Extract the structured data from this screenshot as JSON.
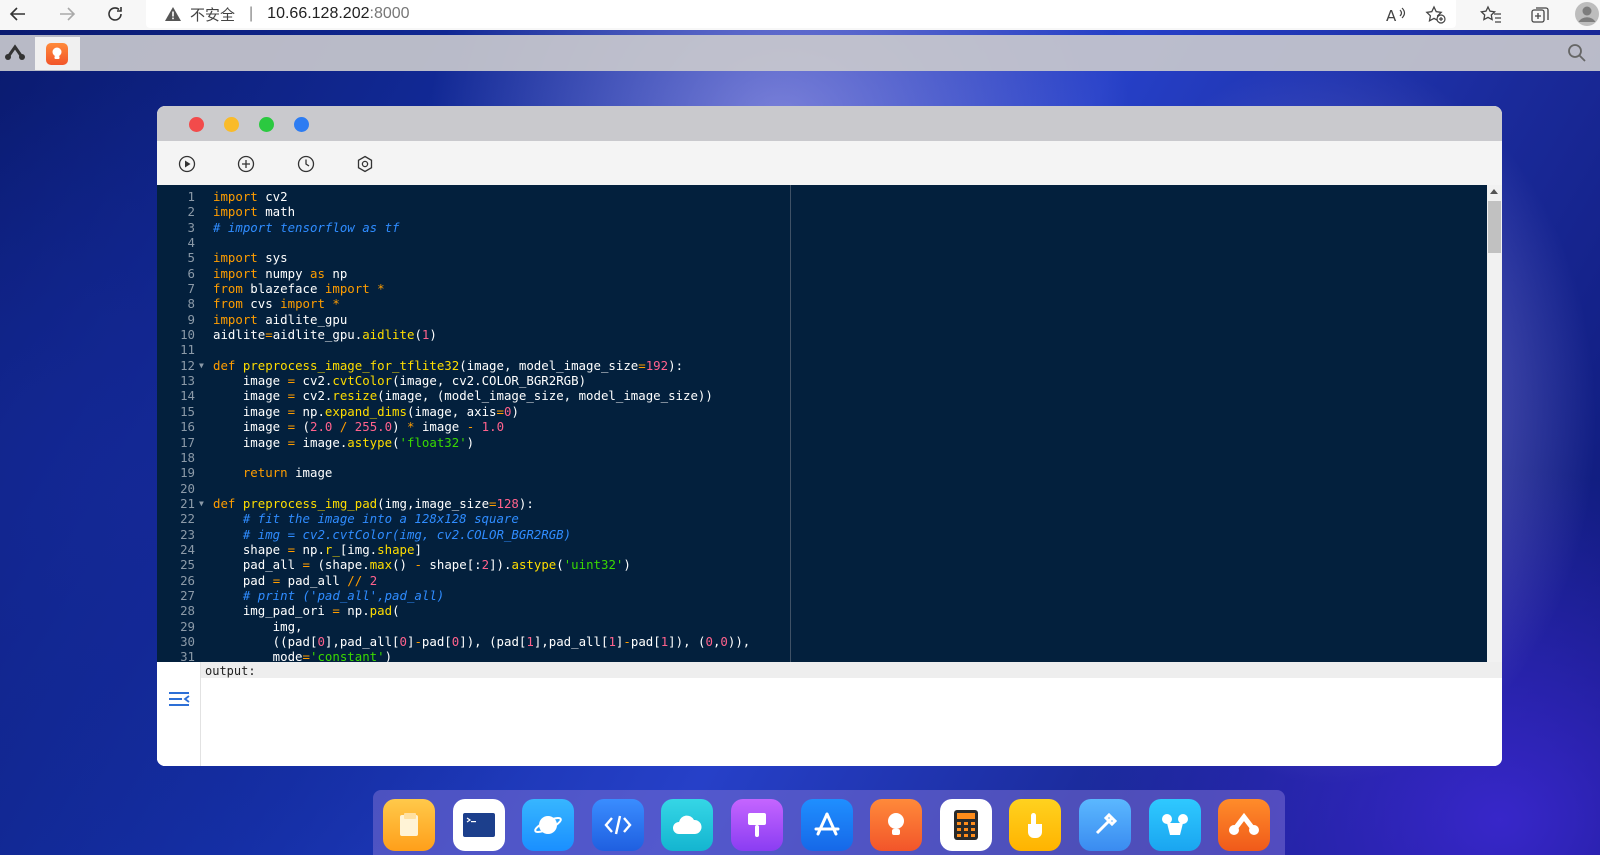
{
  "browser": {
    "insecure_label": "不安全",
    "separator": "|",
    "host": "10.66.128.202",
    "port": ":8000"
  },
  "editor": {
    "lines": [
      {
        "n": "1",
        "fold": false,
        "tokens": [
          [
            "kw",
            "import"
          ],
          [
            "t",
            " cv2"
          ]
        ]
      },
      {
        "n": "2",
        "fold": false,
        "tokens": [
          [
            "kw",
            "import"
          ],
          [
            "t",
            " math"
          ]
        ]
      },
      {
        "n": "3",
        "fold": false,
        "tokens": [
          [
            "cm",
            "# import tensorflow as tf"
          ]
        ]
      },
      {
        "n": "4",
        "fold": false,
        "tokens": []
      },
      {
        "n": "5",
        "fold": false,
        "tokens": [
          [
            "kw",
            "import"
          ],
          [
            "t",
            " sys"
          ]
        ]
      },
      {
        "n": "6",
        "fold": false,
        "tokens": [
          [
            "kw",
            "import"
          ],
          [
            "t",
            " numpy "
          ],
          [
            "kw",
            "as"
          ],
          [
            "t",
            " np"
          ]
        ]
      },
      {
        "n": "7",
        "fold": false,
        "tokens": [
          [
            "kw",
            "from"
          ],
          [
            "t",
            " blazeface "
          ],
          [
            "kw",
            "import"
          ],
          [
            "t",
            " "
          ],
          [
            "op",
            "*"
          ]
        ]
      },
      {
        "n": "8",
        "fold": false,
        "tokens": [
          [
            "kw",
            "from"
          ],
          [
            "t",
            " cvs "
          ],
          [
            "kw",
            "import"
          ],
          [
            "t",
            " "
          ],
          [
            "op",
            "*"
          ]
        ]
      },
      {
        "n": "9",
        "fold": false,
        "tokens": [
          [
            "kw",
            "import"
          ],
          [
            "t",
            " aidlite_gpu"
          ]
        ]
      },
      {
        "n": "10",
        "fold": false,
        "tokens": [
          [
            "t",
            "aidlite"
          ],
          [
            "op",
            "="
          ],
          [
            "t",
            "aidlite_gpu."
          ],
          [
            "fn",
            "aidlite"
          ],
          [
            "t",
            "("
          ],
          [
            "num",
            "1"
          ],
          [
            "t",
            ")"
          ]
        ]
      },
      {
        "n": "11",
        "fold": false,
        "tokens": []
      },
      {
        "n": "12",
        "fold": true,
        "tokens": [
          [
            "kw",
            "def"
          ],
          [
            "t",
            " "
          ],
          [
            "fn",
            "preprocess_image_for_tflite32"
          ],
          [
            "t",
            "(image, model_image_size"
          ],
          [
            "op",
            "="
          ],
          [
            "num",
            "192"
          ],
          [
            "t",
            "):"
          ]
        ]
      },
      {
        "n": "13",
        "fold": false,
        "tokens": [
          [
            "t",
            "    image "
          ],
          [
            "op",
            "="
          ],
          [
            "t",
            " cv2."
          ],
          [
            "fn",
            "cvtColor"
          ],
          [
            "t",
            "(image, cv2.COLOR_BGR2RGB)"
          ]
        ]
      },
      {
        "n": "14",
        "fold": false,
        "tokens": [
          [
            "t",
            "    image "
          ],
          [
            "op",
            "="
          ],
          [
            "t",
            " cv2."
          ],
          [
            "fn",
            "resize"
          ],
          [
            "t",
            "(image, (model_image_size, model_image_size))"
          ]
        ]
      },
      {
        "n": "15",
        "fold": false,
        "tokens": [
          [
            "t",
            "    image "
          ],
          [
            "op",
            "="
          ],
          [
            "t",
            " np."
          ],
          [
            "fn",
            "expand_dims"
          ],
          [
            "t",
            "(image, axis"
          ],
          [
            "op",
            "="
          ],
          [
            "num",
            "0"
          ],
          [
            "t",
            ")"
          ]
        ]
      },
      {
        "n": "16",
        "fold": false,
        "tokens": [
          [
            "t",
            "    image "
          ],
          [
            "op",
            "="
          ],
          [
            "t",
            " ("
          ],
          [
            "num",
            "2.0"
          ],
          [
            "t",
            " "
          ],
          [
            "op",
            "/"
          ],
          [
            "t",
            " "
          ],
          [
            "num",
            "255.0"
          ],
          [
            "t",
            ") "
          ],
          [
            "op",
            "*"
          ],
          [
            "t",
            " image "
          ],
          [
            "op",
            "-"
          ],
          [
            "t",
            " "
          ],
          [
            "num",
            "1.0"
          ]
        ]
      },
      {
        "n": "17",
        "fold": false,
        "tokens": [
          [
            "t",
            "    image "
          ],
          [
            "op",
            "="
          ],
          [
            "t",
            " image."
          ],
          [
            "fn",
            "astype"
          ],
          [
            "t",
            "("
          ],
          [
            "str",
            "'float32'"
          ],
          [
            "t",
            ")"
          ]
        ]
      },
      {
        "n": "18",
        "fold": false,
        "tokens": []
      },
      {
        "n": "19",
        "fold": false,
        "tokens": [
          [
            "t",
            "    "
          ],
          [
            "kw",
            "return"
          ],
          [
            "t",
            " image"
          ]
        ]
      },
      {
        "n": "20",
        "fold": false,
        "tokens": []
      },
      {
        "n": "21",
        "fold": true,
        "tokens": [
          [
            "kw",
            "def"
          ],
          [
            "t",
            " "
          ],
          [
            "fn",
            "preprocess_img_pad"
          ],
          [
            "t",
            "(img,image_size"
          ],
          [
            "op",
            "="
          ],
          [
            "num",
            "128"
          ],
          [
            "t",
            "):"
          ]
        ]
      },
      {
        "n": "22",
        "fold": false,
        "tokens": [
          [
            "t",
            "    "
          ],
          [
            "cm",
            "# fit the image into a 128x128 square"
          ]
        ]
      },
      {
        "n": "23",
        "fold": false,
        "tokens": [
          [
            "t",
            "    "
          ],
          [
            "cm",
            "# img = cv2.cvtColor(img, cv2.COLOR_BGR2RGB)"
          ]
        ]
      },
      {
        "n": "24",
        "fold": false,
        "tokens": [
          [
            "t",
            "    shape "
          ],
          [
            "op",
            "="
          ],
          [
            "t",
            " np."
          ],
          [
            "fn",
            "r_"
          ],
          [
            "t",
            "[img."
          ],
          [
            "fn",
            "shape"
          ],
          [
            "t",
            "]"
          ]
        ]
      },
      {
        "n": "25",
        "fold": false,
        "tokens": [
          [
            "t",
            "    pad_all "
          ],
          [
            "op",
            "="
          ],
          [
            "t",
            " (shape."
          ],
          [
            "fn",
            "max"
          ],
          [
            "t",
            "() "
          ],
          [
            "op",
            "-"
          ],
          [
            "t",
            " shape[:"
          ],
          [
            "num",
            "2"
          ],
          [
            "t",
            "])."
          ],
          [
            "fn",
            "astype"
          ],
          [
            "t",
            "("
          ],
          [
            "str",
            "'uint32'"
          ],
          [
            "t",
            ")"
          ]
        ]
      },
      {
        "n": "26",
        "fold": false,
        "tokens": [
          [
            "t",
            "    pad "
          ],
          [
            "op",
            "="
          ],
          [
            "t",
            " pad_all "
          ],
          [
            "op",
            "//"
          ],
          [
            "t",
            " "
          ],
          [
            "num",
            "2"
          ]
        ]
      },
      {
        "n": "27",
        "fold": false,
        "tokens": [
          [
            "t",
            "    "
          ],
          [
            "cm",
            "# print ('pad_all',pad_all)"
          ]
        ]
      },
      {
        "n": "28",
        "fold": false,
        "tokens": [
          [
            "t",
            "    img_pad_ori "
          ],
          [
            "op",
            "="
          ],
          [
            "t",
            " np."
          ],
          [
            "fn",
            "pad"
          ],
          [
            "t",
            "("
          ]
        ]
      },
      {
        "n": "29",
        "fold": false,
        "tokens": [
          [
            "t",
            "        img,"
          ]
        ]
      },
      {
        "n": "30",
        "fold": false,
        "tokens": [
          [
            "t",
            "        ((pad["
          ],
          [
            "num",
            "0"
          ],
          [
            "t",
            "],pad_all["
          ],
          [
            "num",
            "0"
          ],
          [
            "t",
            "]"
          ],
          [
            "op",
            "-"
          ],
          [
            "t",
            "pad["
          ],
          [
            "num",
            "0"
          ],
          [
            "t",
            "]), (pad["
          ],
          [
            "num",
            "1"
          ],
          [
            "t",
            "],pad_all["
          ],
          [
            "num",
            "1"
          ],
          [
            "t",
            "]"
          ],
          [
            "op",
            "-"
          ],
          [
            "t",
            "pad["
          ],
          [
            "num",
            "1"
          ],
          [
            "t",
            "]), ("
          ],
          [
            "num",
            "0"
          ],
          [
            "t",
            ","
          ],
          [
            "num",
            "0"
          ],
          [
            "t",
            ")),"
          ]
        ]
      },
      {
        "n": "31",
        "fold": false,
        "tokens": [
          [
            "t",
            "        mode"
          ],
          [
            "op",
            "="
          ],
          [
            "str",
            "'constant'"
          ],
          [
            "t",
            ")"
          ]
        ]
      }
    ]
  },
  "output": {
    "label": "output:"
  },
  "colors": {
    "editor_bg": "#03203d",
    "keyword": "#ff9d00",
    "comment": "#2f8cff",
    "number": "#ff628c",
    "string": "#3ad900",
    "function": "#ffdd00"
  },
  "dock": {
    "apps": [
      "files-app-icon",
      "terminal-app-icon",
      "browser-app-icon",
      "code-editor-app-icon",
      "cloud-app-icon",
      "paint-app-icon",
      "app-store-icon",
      "idea-bulb-app-icon",
      "calculator-app-icon",
      "touch-app-icon",
      "tools-app-icon",
      "mouse-app-icon",
      "aidlux-app-icon"
    ]
  }
}
